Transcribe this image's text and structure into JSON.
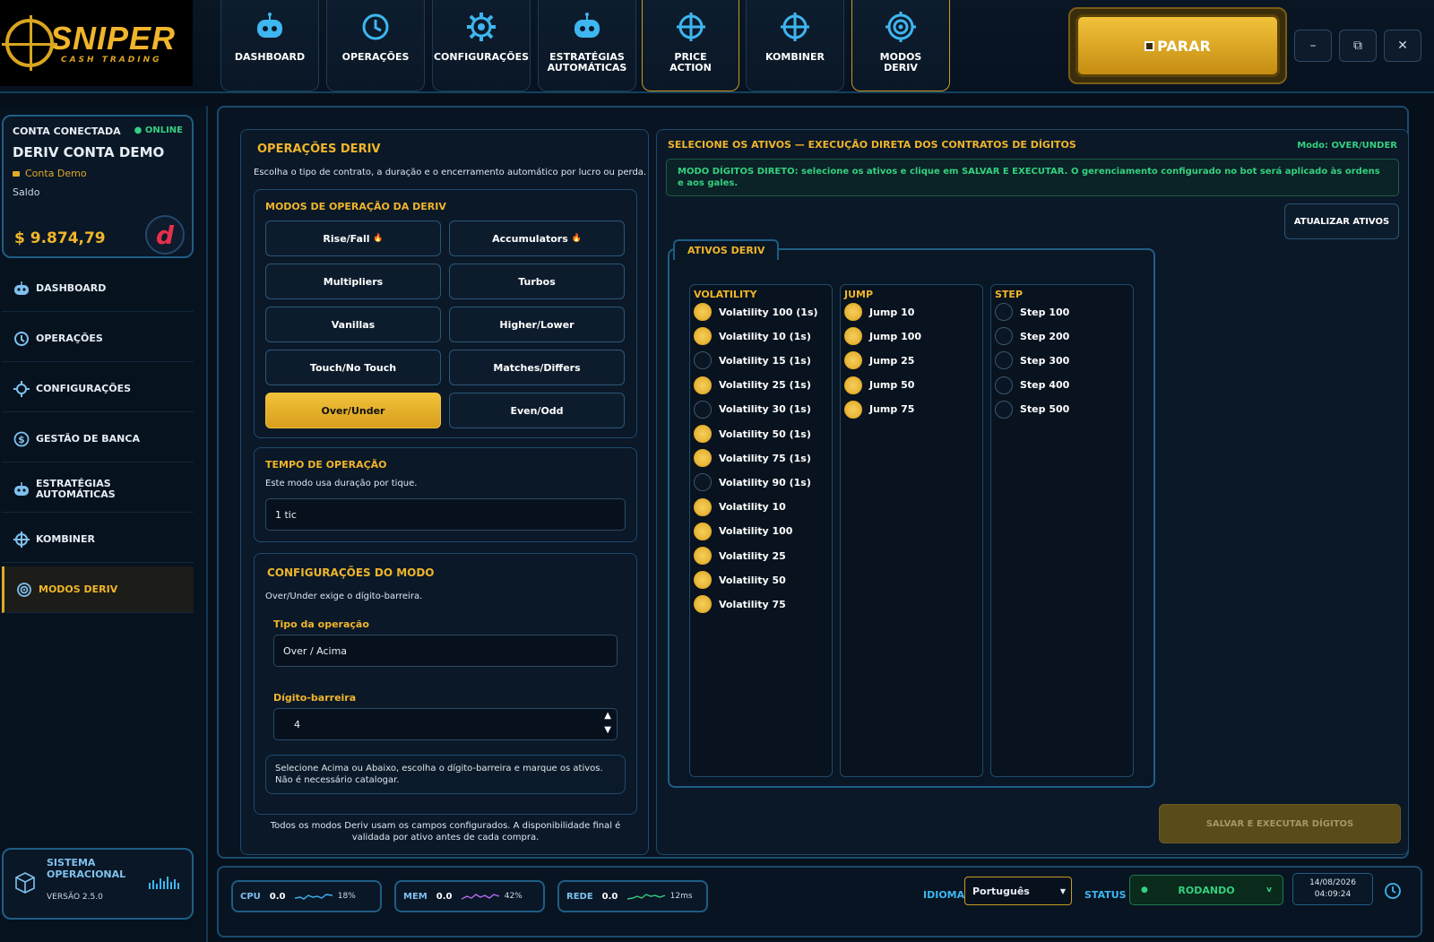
{
  "brand": {
    "name": "SNIPER",
    "tagline": "CASH TRADING"
  },
  "nav_tabs": [
    {
      "label": "DASHBOARD",
      "icon": "robot-icon"
    },
    {
      "label": "OPERAÇÕES",
      "icon": "clock-icon"
    },
    {
      "label": "CONFIGURAÇÕES",
      "icon": "gear-icon"
    },
    {
      "label": "ESTRATÉGIAS\nAUTOMÁTICAS",
      "icon": "robot-icon"
    },
    {
      "label": "PRICE\nACTION",
      "icon": "crosshair-icon"
    },
    {
      "label": "KOMBINER",
      "icon": "crosshair-icon"
    },
    {
      "label": "MODOS\nDERIV",
      "icon": "target-icon"
    }
  ],
  "stop_button": "PARAR",
  "window_controls": {
    "minimize": "–",
    "restore": "⧉",
    "close": "✕"
  },
  "account": {
    "header": "CONTA CONECTADA",
    "status": "● ONLINE",
    "name": "DERIV CONTA DEMO",
    "type": "Conta Demo",
    "balance_label": "Saldo",
    "balance": "$ 9.874,79",
    "logo_letter": "d"
  },
  "sidebar": [
    {
      "label": "DASHBOARD",
      "icon": "robot-icon"
    },
    {
      "label": "OPERAÇÕES",
      "icon": "clock-icon"
    },
    {
      "label": "CONFIGURAÇÕES",
      "icon": "gear-icon"
    },
    {
      "label": "GESTÃO DE BANCA",
      "icon": "dollar-icon"
    },
    {
      "label": "ESTRATÉGIAS AUTOMÁTICAS",
      "icon": "robot-icon"
    },
    {
      "label": "KOMBINER",
      "icon": "crosshair-icon"
    },
    {
      "label": "MODOS DERIV",
      "icon": "target-icon",
      "active": true
    }
  ],
  "system": {
    "title": "SISTEMA OPERACIONAL",
    "version": "VERSÃO 2.5.0"
  },
  "ops": {
    "title": "OPERAÇÕES DERIV",
    "subtitle": "Escolha o tipo de contrato, a duração e o encerramento automático por lucro ou perda.",
    "modes_title": "MODOS DE OPERAÇÃO DA DERIV",
    "modes": [
      "Rise/Fall",
      "Accumulators",
      "Multipliers",
      "Turbos",
      "Vanillas",
      "Higher/Lower",
      "Touch/No Touch",
      "Matches/Differs",
      "Over/Under",
      "Even/Odd"
    ],
    "selected_mode": "Over/Under",
    "fire_emoji": "🔥",
    "time_title": "TEMPO DE OPERAÇÃO",
    "time_desc": "Este modo usa duração por tique.",
    "time_value": "1 tic",
    "config_title": "CONFIGURAÇÕES DO MODO",
    "config_desc": "Over/Under exige o dígito-barreira.",
    "op_type_label": "Tipo da operação",
    "op_type_value": "Over / Acima",
    "barrier_label": "Dígito-barreira",
    "barrier_value": "4",
    "hint": "Selecione Acima ou Abaixo, escolha o dígito-barreira e marque os ativos. Não é necessário catalogar.",
    "footer": "Todos os modos Deriv usam os campos configurados. A disponibilidade final é validada por ativo antes de cada compra."
  },
  "assets": {
    "title": "SELECIONE OS ATIVOS — EXECUÇÃO DIRETA DOS CONTRATOS DE DÍGITOS",
    "mode": "Modo: OVER/UNDER",
    "notice": "MODO DÍGITOS DIRETO: selecione os ativos e clique em SALVAR E EXECUTAR. O gerenciamento configurado no bot será aplicado às ordens e aos gales.",
    "refresh": "ATUALIZAR ATIVOS",
    "group_title": "ATIVOS DERIV",
    "save": "SALVAR E EXECUTAR DÍGITOS",
    "columns": [
      {
        "title": "VOLATILITY",
        "items": [
          {
            "label": "Volatility 100 (1s)",
            "checked": true
          },
          {
            "label": "Volatility 10 (1s)",
            "checked": true
          },
          {
            "label": "Volatility 15 (1s)",
            "checked": false
          },
          {
            "label": "Volatility 25 (1s)",
            "checked": true
          },
          {
            "label": "Volatility 30 (1s)",
            "checked": false
          },
          {
            "label": "Volatility 50 (1s)",
            "checked": true
          },
          {
            "label": "Volatility 75 (1s)",
            "checked": true
          },
          {
            "label": "Volatility 90 (1s)",
            "checked": false
          },
          {
            "label": "Volatility 10",
            "checked": true
          },
          {
            "label": "Volatility 100",
            "checked": true
          },
          {
            "label": "Volatility 25",
            "checked": true
          },
          {
            "label": "Volatility 50",
            "checked": true
          },
          {
            "label": "Volatility 75",
            "checked": true
          }
        ]
      },
      {
        "title": "JUMP",
        "items": [
          {
            "label": "Jump 10",
            "checked": true
          },
          {
            "label": "Jump 100",
            "checked": true
          },
          {
            "label": "Jump 25",
            "checked": true
          },
          {
            "label": "Jump 50",
            "checked": true
          },
          {
            "label": "Jump 75",
            "checked": true
          }
        ]
      },
      {
        "title": "STEP",
        "items": [
          {
            "label": "Step 100",
            "checked": false
          },
          {
            "label": "Step 200",
            "checked": false
          },
          {
            "label": "Step 300",
            "checked": false
          },
          {
            "label": "Step 400",
            "checked": false
          },
          {
            "label": "Step 500",
            "checked": false
          }
        ]
      }
    ]
  },
  "status_bar": {
    "cpu": {
      "label": "CPU",
      "value": "0.0",
      "pct": "18%"
    },
    "mem": {
      "label": "MEM",
      "value": "0.0",
      "pct": "42%"
    },
    "net": {
      "label": "REDE",
      "value": "0.0",
      "pct": "12ms"
    },
    "lang_label": "IDIOMA",
    "lang_value": "Português",
    "status_label": "STATUS",
    "status_value": "RODANDO",
    "date": "14/08/2026",
    "time": "04:09:24"
  },
  "colors": {
    "accent": "#f0b52a",
    "online": "#35d07f",
    "panel_border": "#1e4a6c"
  }
}
